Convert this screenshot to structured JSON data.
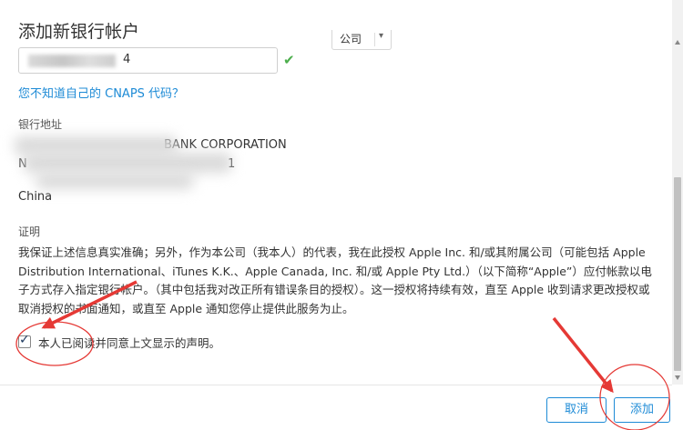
{
  "dialog": {
    "title": "添加新银行帐户",
    "account_type": "公司",
    "account_number_suffix": "4",
    "cnaps_link": "您不知道自己的 CNAPS 代码？",
    "bank_address_label": "银行地址",
    "bank_address_line1": "BANK CORPORATION",
    "bank_address_line2_start": "N",
    "bank_address_line2_end": "1",
    "bank_address_country": "China",
    "certification_label": "证明",
    "certification_text": "我保证上述信息真实准确；另外，作为本公司（我本人）的代表，我在此授权 Apple Inc. 和/或其附属公司（可能包括 Apple Distribution International、iTunes K.K.、Apple Canada, Inc. 和/或 Apple Pty Ltd.）（以下简称“Apple”）应付帐款以电子方式存入指定银行帐户。（其中包括我对改正所有错误条目的授权）。这一授权将持续有效，直至 Apple 收到请求更改授权或取消授权的书面通知，或直至 Apple 通知您停止提供此服务为止。",
    "agree_label": "本人已阅读并同意上文显示的声明。",
    "cancel_button": "取消",
    "add_button": "添加"
  },
  "colors": {
    "link": "#1e8bd6",
    "check_ok": "#4cae4c",
    "annotation": "#e53935"
  },
  "icons": {
    "account_type_chevron": "chevron-down-icon",
    "valid_check": "check-icon"
  }
}
